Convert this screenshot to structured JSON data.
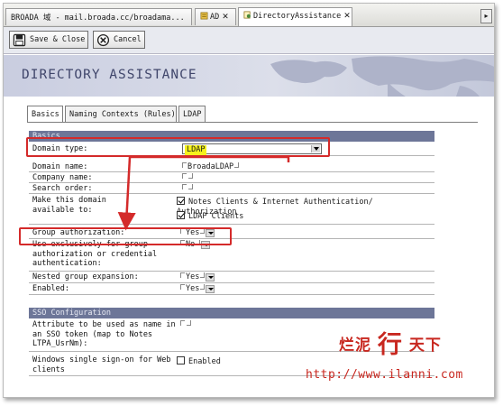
{
  "browser_tabs": [
    {
      "label": "BROADA 域 - mail.broada.cc/broadama...",
      "active": false
    },
    {
      "label": "AD",
      "active": false
    },
    {
      "label": "DirectoryAssistance",
      "active": true
    }
  ],
  "toolbar": {
    "save_close_label": "Save & Close",
    "cancel_label": "Cancel"
  },
  "header": {
    "title": "DIRECTORY ASSISTANCE"
  },
  "form_tabs": [
    {
      "label": "Basics",
      "active": true
    },
    {
      "label": "Naming Contexts (Rules)",
      "active": false
    },
    {
      "label": "LDAP",
      "active": false
    }
  ],
  "basics": {
    "section_title": "Basics",
    "domain_type": {
      "label": "Domain type:",
      "value": "LDAP"
    },
    "domain_name": {
      "label": "Domain name:",
      "value": "BroadaLDAP"
    },
    "company_name": {
      "label": "Company name:",
      "value": ""
    },
    "search_order": {
      "label": "Search order:",
      "value": ""
    },
    "make_available": {
      "label": "Make this domain available to:",
      "options": [
        {
          "label": "Notes Clients & Internet Authentication/ Authorization",
          "checked": true
        },
        {
          "label": "LDAP Clients",
          "checked": true
        }
      ]
    },
    "group_authorization": {
      "label": "Group authorization:",
      "value": "Yes"
    },
    "use_exclusively": {
      "label": "Use exclusively for group authorization or credential authentication:",
      "value": "No"
    },
    "nested_group": {
      "label": "Nested group expansion:",
      "value": "Yes"
    },
    "enabled": {
      "label": "Enabled:",
      "value": "Yes"
    }
  },
  "sso": {
    "section_title": "SSO Configuration",
    "attribute": {
      "label": "Attribute to be used as name in an SSO token (map to Notes LTPA_UsrNm):",
      "value": ""
    },
    "windows_sso": {
      "label": "Windows single sign-on for Web clients",
      "option_label": "Enabled",
      "checked": false
    }
  },
  "watermark": {
    "cn_prefix": "烂泥",
    "cn_big": "行",
    "cn_suffix": "天下",
    "url": "http://www.ilanni.com"
  },
  "colors": {
    "annotation": "#d42a2a",
    "section_bar": "#6d7698",
    "highlight": "#f6f21c"
  }
}
